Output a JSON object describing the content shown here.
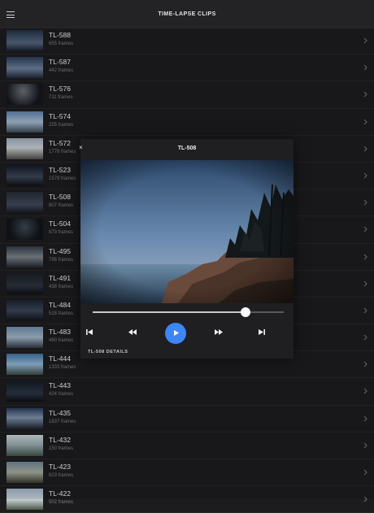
{
  "header": {
    "title": "TIME-LAPSE CLIPS",
    "menu_icon": "hamburger-icon"
  },
  "clips": [
    {
      "name": "TL-588",
      "frames": "655 frames",
      "thumb": "linear-gradient(#223044,#51637a 60%,#181e2a)"
    },
    {
      "name": "TL-587",
      "frames": "442 frames",
      "thumb": "linear-gradient(#2a3b56,#6a7d97 55%,#202836)"
    },
    {
      "name": "TL-576",
      "frames": "711 frames",
      "thumb": "radial-gradient(circle at 45% 35%,#6a6f78,#14161c 70%)"
    },
    {
      "name": "TL-574",
      "frames": "255 frames",
      "thumb": "linear-gradient(#5b7ea6,#a3b8cc 50%,#3b4654)"
    },
    {
      "name": "TL-572",
      "frames": "1778 frames",
      "thumb": "linear-gradient(#9aa7b6,#c6cbcf 45%,#4c4a45)"
    },
    {
      "name": "TL-523",
      "frames": "1579 frames",
      "thumb": "linear-gradient(#141824,#3a4454 55%,#0e1016)"
    },
    {
      "name": "TL-508",
      "frames": "807 frames",
      "thumb": "linear-gradient(#242a36,#404858 60%,#151820)"
    },
    {
      "name": "TL-504",
      "frames": "873 frames",
      "thumb": "radial-gradient(circle at 50% 40%,#3c4650,#10141a 70%)"
    },
    {
      "name": "TL-495",
      "frames": "795 frames",
      "thumb": "linear-gradient(#303844,#7a8088 50%,#20242a)"
    },
    {
      "name": "TL-491",
      "frames": "438 frames",
      "thumb": "linear-gradient(#1a1e26,#2c323c 60%,#0d0f13)"
    },
    {
      "name": "TL-484",
      "frames": "518 frames",
      "thumb": "linear-gradient(#1c2230,#394356 50%,#111319)"
    },
    {
      "name": "TL-483",
      "frames": "490 frames",
      "thumb": "linear-gradient(#6d8aa8,#9fb2c3 50%,#2f3540)"
    },
    {
      "name": "TL-444",
      "frames": "1333 frames",
      "thumb": "linear-gradient(#3d6e9c,#8fb3d0 50%,#3a4a44)"
    },
    {
      "name": "TL-443",
      "frames": "424 frames",
      "thumb": "linear-gradient(#141922,#2a3444 60%,#0d1016)"
    },
    {
      "name": "TL-435",
      "frames": "1837 frames",
      "thumb": "linear-gradient(#2a3c58,#7c8ea6 45%,#1a1e26)"
    },
    {
      "name": "TL-432",
      "frames": "150 frames",
      "thumb": "linear-gradient(#c7d0d6,#8fa2a6 50%,#425046)"
    },
    {
      "name": "TL-423",
      "frames": "823 frames",
      "thumb": "linear-gradient(#6f8494,#a2a89c 50%,#3a3a2e)"
    },
    {
      "name": "TL-422",
      "frames": "502 frames",
      "thumb": "linear-gradient(#9db0c4,#c9d2d8 50%,#4a5848)"
    }
  ],
  "row_chevron": "chevron-right-icon",
  "player": {
    "title": "TL-508",
    "close_glyph": "×",
    "progress": 0.8,
    "details_label": "TL-508 DETAILS",
    "controls": {
      "skip_back": "skip-back-icon",
      "rewind": "rewind-icon",
      "play": "play-icon",
      "fast_forward": "fast-forward-icon",
      "skip_forward": "skip-forward-icon"
    },
    "accent_color": "#3d86f5"
  }
}
